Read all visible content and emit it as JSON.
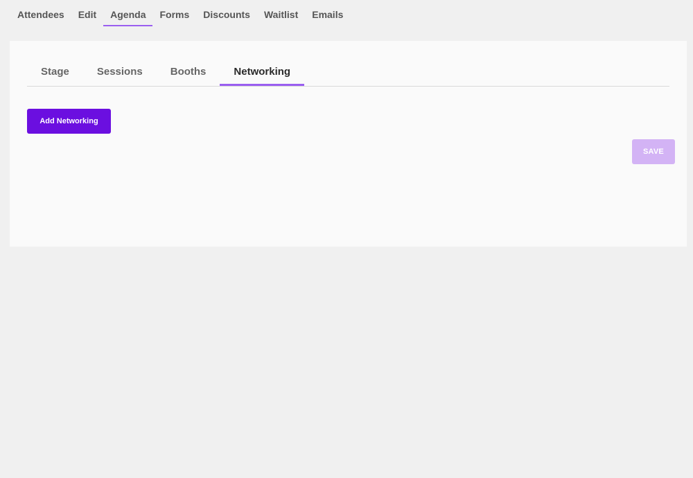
{
  "top_nav": {
    "items": [
      {
        "label": "Attendees"
      },
      {
        "label": "Edit"
      },
      {
        "label": "Agenda"
      },
      {
        "label": "Forms"
      },
      {
        "label": "Discounts"
      },
      {
        "label": "Waitlist"
      },
      {
        "label": "Emails"
      }
    ],
    "active": "Agenda"
  },
  "sub_tabs": {
    "items": [
      {
        "label": "Stage"
      },
      {
        "label": "Sessions"
      },
      {
        "label": "Booths"
      },
      {
        "label": "Networking"
      }
    ],
    "active": "Networking"
  },
  "actions": {
    "add_label": "Add Networking",
    "save_label": "SAVE",
    "save_disabled": true
  },
  "colors": {
    "accent": "#9a5ef0",
    "primary_button": "#6b0fe0",
    "disabled_button": "#d3b3f5",
    "page_background": "#f0f0f0",
    "card_background": "#fafafa"
  }
}
